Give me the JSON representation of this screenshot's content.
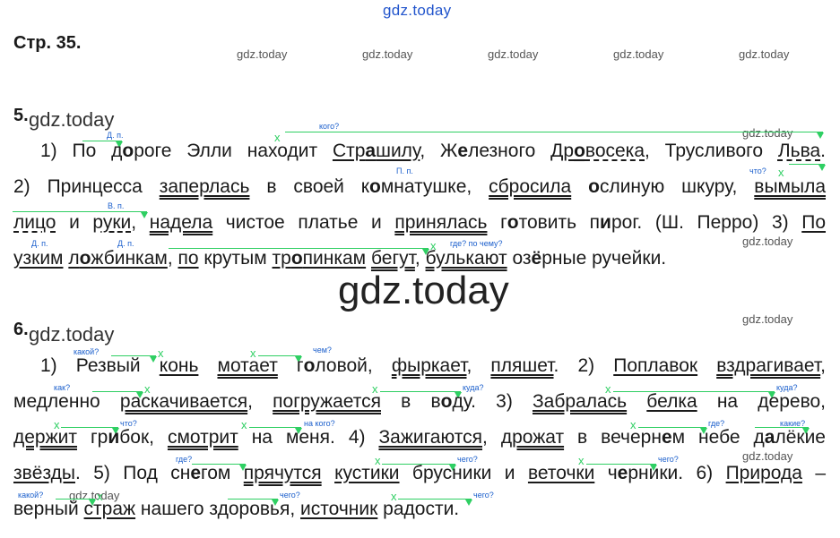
{
  "watermark_top": "gdz.today",
  "page_ref": "Стр. 35.",
  "watermark_small": "gdz.today",
  "watermark_big": "gdz.today",
  "exercise5": {
    "number": "5.",
    "questions": [
      "кого?",
      "Д. п.",
      "П. п.",
      "что?",
      "В. п.",
      "Д. п.",
      "Д. п.",
      "где? по чему?"
    ],
    "l1": {
      "a": "1) По д",
      "b": "о",
      "c": "роге Элли находит ",
      "d": "Стр",
      "e": "а",
      "f": "шилу",
      "g": ", Ж",
      "h": "е",
      "i": "лезного ",
      "j": "Др",
      "k": "о",
      "l": "восека",
      "m": ", Трусливого ",
      "n": "Льва",
      "o": "."
    },
    "l2": {
      "a": "2) Принцесса ",
      "b": "заперлась",
      "c": " в своей к",
      "d": "о",
      "e": "мнатушке",
      "f": ", ",
      "g": "сбросила",
      "h": " ",
      "i": "о",
      "j": "слиную шкуру",
      "k": ", ",
      "l": "вымыла"
    },
    "l3": {
      "a": "лицо",
      "b": " и ",
      "c": "руки",
      "d": ", ",
      "e": "надела",
      "f": " чистое платье и ",
      "g": "принялась",
      "h": " г",
      "i": "о",
      "j": "товить п",
      "k": "и",
      "l": "рог. (Ш. Перро) 3) ",
      "m": "По"
    },
    "l4": {
      "a": "узким",
      "b": " ",
      "c": "л",
      "d": "о",
      "e": "жбинкам",
      "f": ", ",
      "g": "по",
      "h": " крутым ",
      "i": "тр",
      "j": "о",
      "k": "пинкам",
      "l": " ",
      "m": "бегут",
      "n": ", ",
      "o": "булькают",
      "p": " оз",
      "q": "ё",
      "r": "рные ручейки."
    }
  },
  "exercise6": {
    "number": "6.",
    "questions": [
      "какой?",
      "чем?",
      "как?",
      "куда?",
      "куда?",
      "что?",
      "на кого?",
      "где?",
      "какие?",
      "где?",
      "чего?",
      "чего?",
      "какой?",
      "чего?",
      "чего?"
    ],
    "l1": {
      "a": "1) Резвый ",
      "b": "конь",
      "c": " ",
      "d": "мотает",
      "e": " г",
      "f": "о",
      "g": "ловой, ",
      "h": "фыркает",
      "i": ", ",
      "j": "пляшет",
      "k": ". 2) ",
      "l": "Поплавок",
      "m": " ",
      "n": "вздрагивает",
      "o": ","
    },
    "l2": {
      "a": "медленно ",
      "b": "раскачивается",
      "c": ", ",
      "d": "погружается",
      "e": " в в",
      "f": "о",
      "g": "ду. 3) ",
      "h": "Забралась",
      "i": " ",
      "j": "белка",
      "k": " на дерево,"
    },
    "l3": {
      "a": "держит",
      "b": " гр",
      "c": "и",
      "d": "бок, ",
      "e": "смотрит",
      "f": " на меня. 4) ",
      "g": "Зажигаются",
      "h": ", ",
      "i": "дрожат",
      "j": " в вечерн",
      "k": "е",
      "l": "м небе д",
      "m": "а",
      "n": "лёкие"
    },
    "l4": {
      "a": "звёзды",
      "b": ". 5) Под сн",
      "c": "е",
      "d": "гом ",
      "e": "прячутся",
      "f": " ",
      "g": "кустики",
      "h": " брусники и ",
      "i": "веточки",
      "j": " ч",
      "k": "е",
      "l": "рники. 6) ",
      "m": "Природа",
      "n": " –"
    },
    "l5": {
      "a": "верный ",
      "b": "страж",
      "c": " нашего здоровья, ",
      "d": "источник",
      "e": " радости."
    }
  }
}
